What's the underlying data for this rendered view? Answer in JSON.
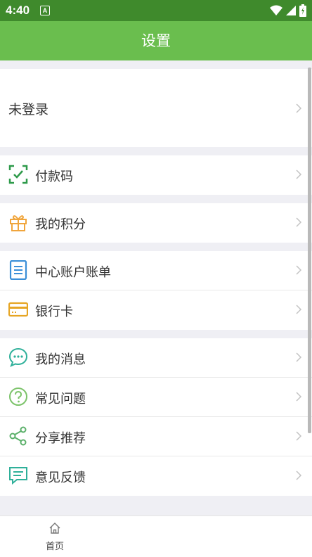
{
  "status": {
    "time": "4:40",
    "notification_glyph": "A"
  },
  "header": {
    "title": "设置"
  },
  "login": {
    "label": "未登录"
  },
  "menu": {
    "pay_code": "付款码",
    "points": "我的积分",
    "bill": "中心账户账单",
    "bank_card": "银行卡",
    "messages": "我的消息",
    "faq": "常见问题",
    "share": "分享推荐",
    "feedback": "意见反馈"
  },
  "bottom_nav": {
    "home_label": "首页"
  },
  "colors": {
    "brand": "#6abe4e",
    "status_bar": "#3f8a2c",
    "icon_green": "#2e9a4a",
    "icon_orange": "#f0a53c",
    "icon_blue": "#3b8fd8",
    "icon_yellow": "#e6a524",
    "icon_teal": "#2fb09a"
  }
}
